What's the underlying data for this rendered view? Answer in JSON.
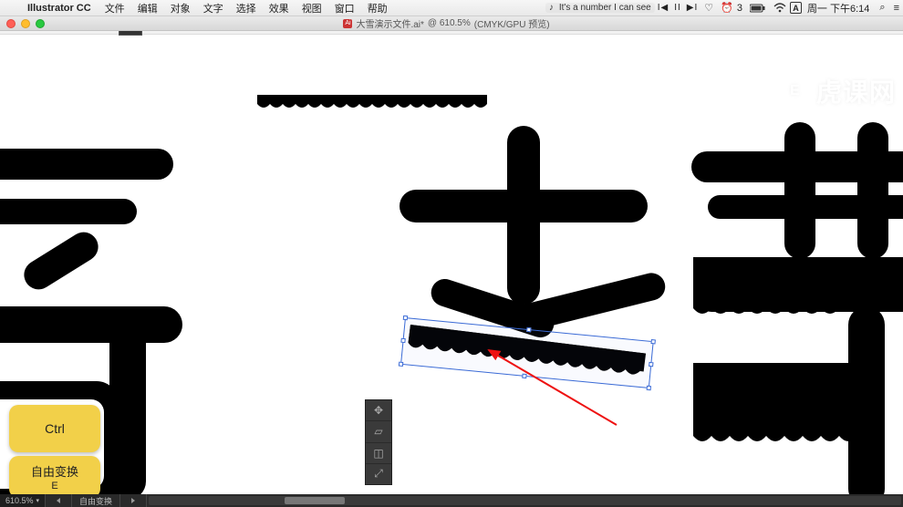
{
  "menubar": {
    "app_name": "Illustrator CC",
    "menus": [
      "文件",
      "编辑",
      "对象",
      "文字",
      "选择",
      "效果",
      "视图",
      "窗口",
      "帮助"
    ],
    "now_playing": "It's a number I can see",
    "playback_icons": [
      "prev",
      "pause",
      "next"
    ],
    "status_icons": {
      "heart": "♡",
      "alarm": "3",
      "battery_pct": "●",
      "wifi": "",
      "input": "A"
    },
    "clock": "周一 下午6:14",
    "search": "⌕",
    "menu_extra": "≡"
  },
  "doc_titlebar": {
    "filename": "大雪演示文件.ai*",
    "zoom": "610.5%",
    "color_mode": "(CMYK/GPU 预览)"
  },
  "watermark": {
    "badge": "E",
    "text": "虎课网"
  },
  "mini_panel": {
    "tools": [
      "free-distort",
      "perspective-distort",
      "puppet-warp",
      "free-transform"
    ]
  },
  "keycaps": {
    "k1": "Ctrl",
    "k2_main": "自由变换",
    "k2_sub": "E"
  },
  "statusbar": {
    "zoom": "610.5%",
    "label": "自由变换"
  },
  "selection": {
    "cursor_hint": "↕"
  }
}
